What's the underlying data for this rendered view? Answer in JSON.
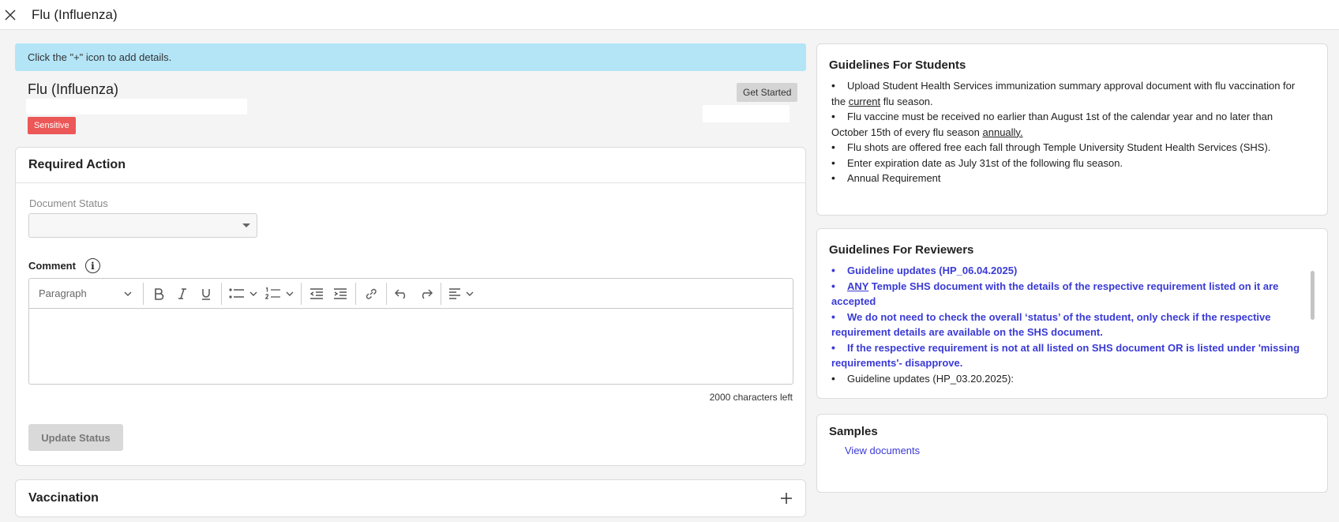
{
  "header": {
    "title": "Flu (Influenza)"
  },
  "banner": {
    "text": "Click the \"+\" icon to add details."
  },
  "requirement": {
    "title": "Flu (Influenza)",
    "badge": "Sensitive",
    "get_started": "Get Started"
  },
  "required_action": {
    "title": "Required Action",
    "document_status_label": "Document Status",
    "document_status_value": "",
    "comment_label": "Comment",
    "editor": {
      "paragraph_label": "Paragraph"
    },
    "chars_left": "2000 characters left",
    "update_button": "Update Status"
  },
  "vaccination": {
    "title": "Vaccination"
  },
  "students": {
    "title": "Guidelines For Students",
    "items": [
      {
        "pre": "Upload Student Health Services immunization summary approval document with flu vaccination for the ",
        "u": "current",
        "post": " flu season."
      },
      {
        "pre": "Flu vaccine must be received no earlier than August 1st of the calendar year and no later than October 15th of every flu season ",
        "u": "annually.",
        "post": ""
      },
      {
        "pre": "Flu shots are offered free each fall through Temple University Student Health Services (SHS).",
        "u": "",
        "post": ""
      },
      {
        "pre": "Enter expiration date as July 31st of the following flu season.",
        "u": "",
        "post": ""
      },
      {
        "pre": "Annual Requirement",
        "u": "",
        "post": ""
      }
    ]
  },
  "reviewers": {
    "title": "Guidelines For Reviewers",
    "items": [
      {
        "u": "",
        "text": "Guideline updates (HP_06.04.2025)"
      },
      {
        "u": "ANY",
        "text": " Temple SHS document with the details of the respective requirement listed on it are accepted"
      },
      {
        "u": "",
        "text": "We do not need to check the overall ‘status’ of the student, only check if the respective requirement details are available on the SHS document."
      },
      {
        "u": "",
        "text": "If the respective requirement is not at all listed on SHS document OR is listed under 'missing requirements'- disapprove."
      },
      {
        "u": "",
        "text": "Guideline updates (HP_03.20.2025):"
      }
    ]
  },
  "samples": {
    "title": "Samples",
    "link": "View documents"
  }
}
